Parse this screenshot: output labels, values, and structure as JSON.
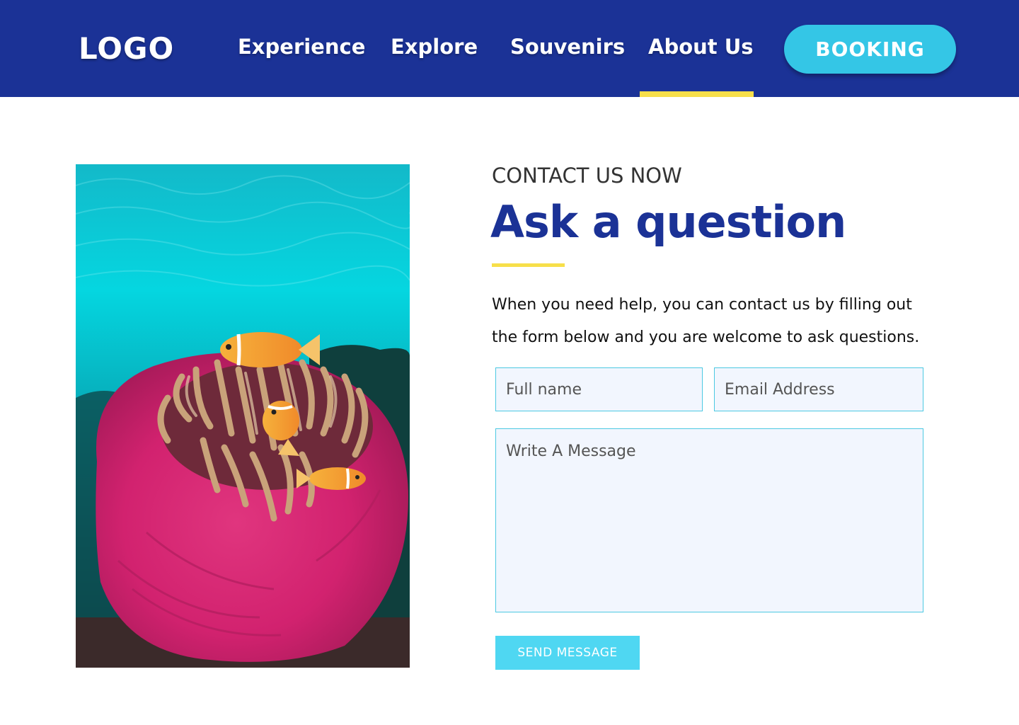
{
  "header": {
    "logo": "LOGO",
    "nav": [
      {
        "label": "Experience"
      },
      {
        "label": "Explore"
      },
      {
        "label": "Souvenirs"
      },
      {
        "label": "About Us",
        "active": true
      }
    ],
    "booking_label": "BOOKING"
  },
  "photo": {
    "subject": "clownfish in pink sea anemone"
  },
  "contact": {
    "eyebrow": "CONTACT US NOW",
    "title": "Ask a question",
    "intro": "When you need help, you can contact us by filling out the form below and you are welcome to ask questions."
  },
  "form": {
    "name_placeholder": "Full name",
    "email_placeholder": "Email Address",
    "message_placeholder": "Write A Message",
    "send_label": "SEND MESSAGE"
  },
  "colors": {
    "header_bg": "#1b3296",
    "accent_yellow": "#f7df4a",
    "button_cyan": "#34c6e6",
    "field_border": "#4cc9e2",
    "field_bg": "#f2f6fe"
  }
}
